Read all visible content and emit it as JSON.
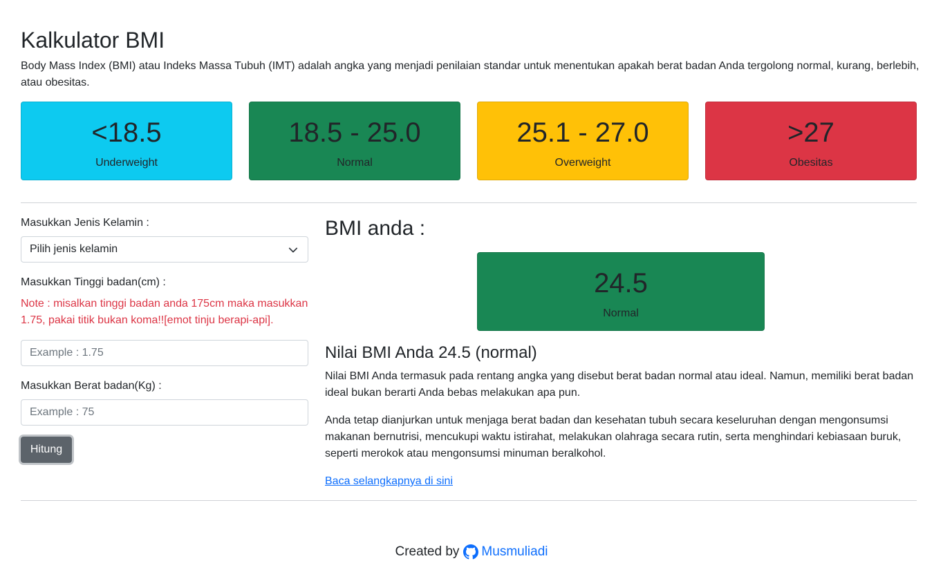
{
  "header": {
    "title": "Kalkulator BMI",
    "intro": "Body Mass Index (BMI) atau Indeks Massa Tubuh (IMT) adalah angka yang menjadi penilaian standar untuk menentukan apakah berat badan Anda tergolong normal, kurang, berlebih, atau obesitas."
  },
  "categories": [
    {
      "range": "<18.5",
      "label": "Underweight",
      "color": "#0dcaf0"
    },
    {
      "range": "18.5 - 25.0",
      "label": "Normal",
      "color": "#198754"
    },
    {
      "range": "25.1 - 27.0",
      "label": "Overweight",
      "color": "#ffc107"
    },
    {
      "range": ">27",
      "label": "Obesitas",
      "color": "#dc3545"
    }
  ],
  "form": {
    "gender_label": "Masukkan Jenis Kelamin :",
    "gender_selected": "Pilih jenis kelamin",
    "height_label": "Masukkan Tinggi badan(cm) :",
    "height_note": "Note : misalkan tinggi badan anda 175cm maka masukkan 1.75, pakai titik bukan koma!![emot tinju berapi-api].",
    "height_placeholder": "Example : 1.75",
    "weight_label": "Masukkan Berat badan(Kg) :",
    "weight_placeholder": "Example : 75",
    "submit_label": "Hitung"
  },
  "result": {
    "title": "BMI anda :",
    "value": "24.5",
    "category": "Normal",
    "color": "#198754",
    "heading": "Nilai BMI Anda 24.5 (normal)",
    "paragraph1": "Nilai BMI Anda termasuk pada rentang angka yang disebut berat badan normal atau ideal. Namun, memiliki berat badan ideal bukan berarti Anda bebas melakukan apa pun.",
    "paragraph2": "Anda tetap dianjurkan untuk menjaga berat badan dan kesehatan tubuh secara keseluruhan dengan mengonsumsi makanan bernutrisi, mencukupi waktu istirahat, melakukan olahraga secara rutin, serta menghindari kebiasaan buruk, seperti merokok atau mengonsumsi minuman beralkohol.",
    "read_more": "Baca selangkapnya di sini"
  },
  "footer": {
    "created_by": "Created by",
    "icon": "github-icon",
    "author": "Musmuliadi"
  }
}
